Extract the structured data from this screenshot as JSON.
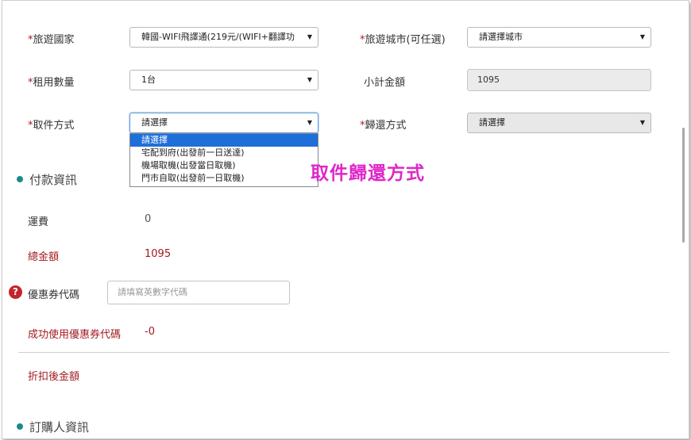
{
  "form": {
    "country": {
      "label": "*旅遊國家",
      "value": "韓國-WIFI飛譯通(219元/(WIFI+翻譯功"
    },
    "city": {
      "label": "*旅遊城市(可任選)",
      "value": "請選擇城市"
    },
    "quantity": {
      "label": "*租用數量",
      "value": "1台"
    },
    "subtotal": {
      "label": "小計金額",
      "value": "1095"
    },
    "pickup": {
      "label": "*取件方式",
      "value": "請選擇",
      "options": [
        "請選擇",
        "宅配到府(出發前一日送達)",
        "機場取機(出發當日取機)",
        "門市自取(出發前一日取機)"
      ],
      "selected_index": 0
    },
    "return": {
      "label": "*歸還方式",
      "value": "請選擇"
    }
  },
  "annotation": "取件歸還方式",
  "payment": {
    "title": "付款資訊",
    "shipping_label": "運費",
    "shipping_value": "0",
    "total_label": "總金額",
    "total_value": "1095",
    "coupon_label": "優惠券代碼",
    "coupon_placeholder": "請填寫英數字代碼",
    "coupon_used_label": "成功使用優惠券代碼",
    "coupon_used_value": "-0",
    "discounted_label": "折扣後金額"
  },
  "buyer": {
    "title": "訂購人資訊"
  },
  "icons": {
    "select_arrow": "▼",
    "help_icon": "?"
  },
  "colors": {
    "required": "#b3171b",
    "accent_dot": "#1b8a8c",
    "annotation": "#e026c9",
    "highlight": "#1e6fd9"
  }
}
